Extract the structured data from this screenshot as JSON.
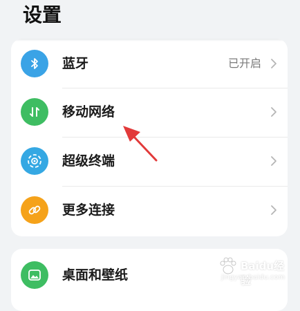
{
  "header": {
    "title": "设置"
  },
  "card_main": {
    "items": [
      {
        "label": "蓝牙",
        "status": "已开启",
        "icon": "bluetooth-icon",
        "color": "#3aa3e6"
      },
      {
        "label": "移动网络",
        "status": "",
        "icon": "mobile-network-icon",
        "color": "#3ebd62"
      },
      {
        "label": "超级终端",
        "status": "",
        "icon": "super-device-icon",
        "color": "#35a8e3"
      },
      {
        "label": "更多连接",
        "status": "",
        "icon": "link-icon",
        "color": "#f5a21a"
      }
    ]
  },
  "card_second": {
    "items": [
      {
        "label": "桌面和壁纸",
        "status": "",
        "icon": "wallpaper-icon",
        "color": "#3ebd62"
      }
    ]
  },
  "annotation": {
    "arrow_color": "#e23a3a"
  },
  "watermark": {
    "title": "Baidu经验",
    "sub": "jingyan.baidu.com"
  }
}
